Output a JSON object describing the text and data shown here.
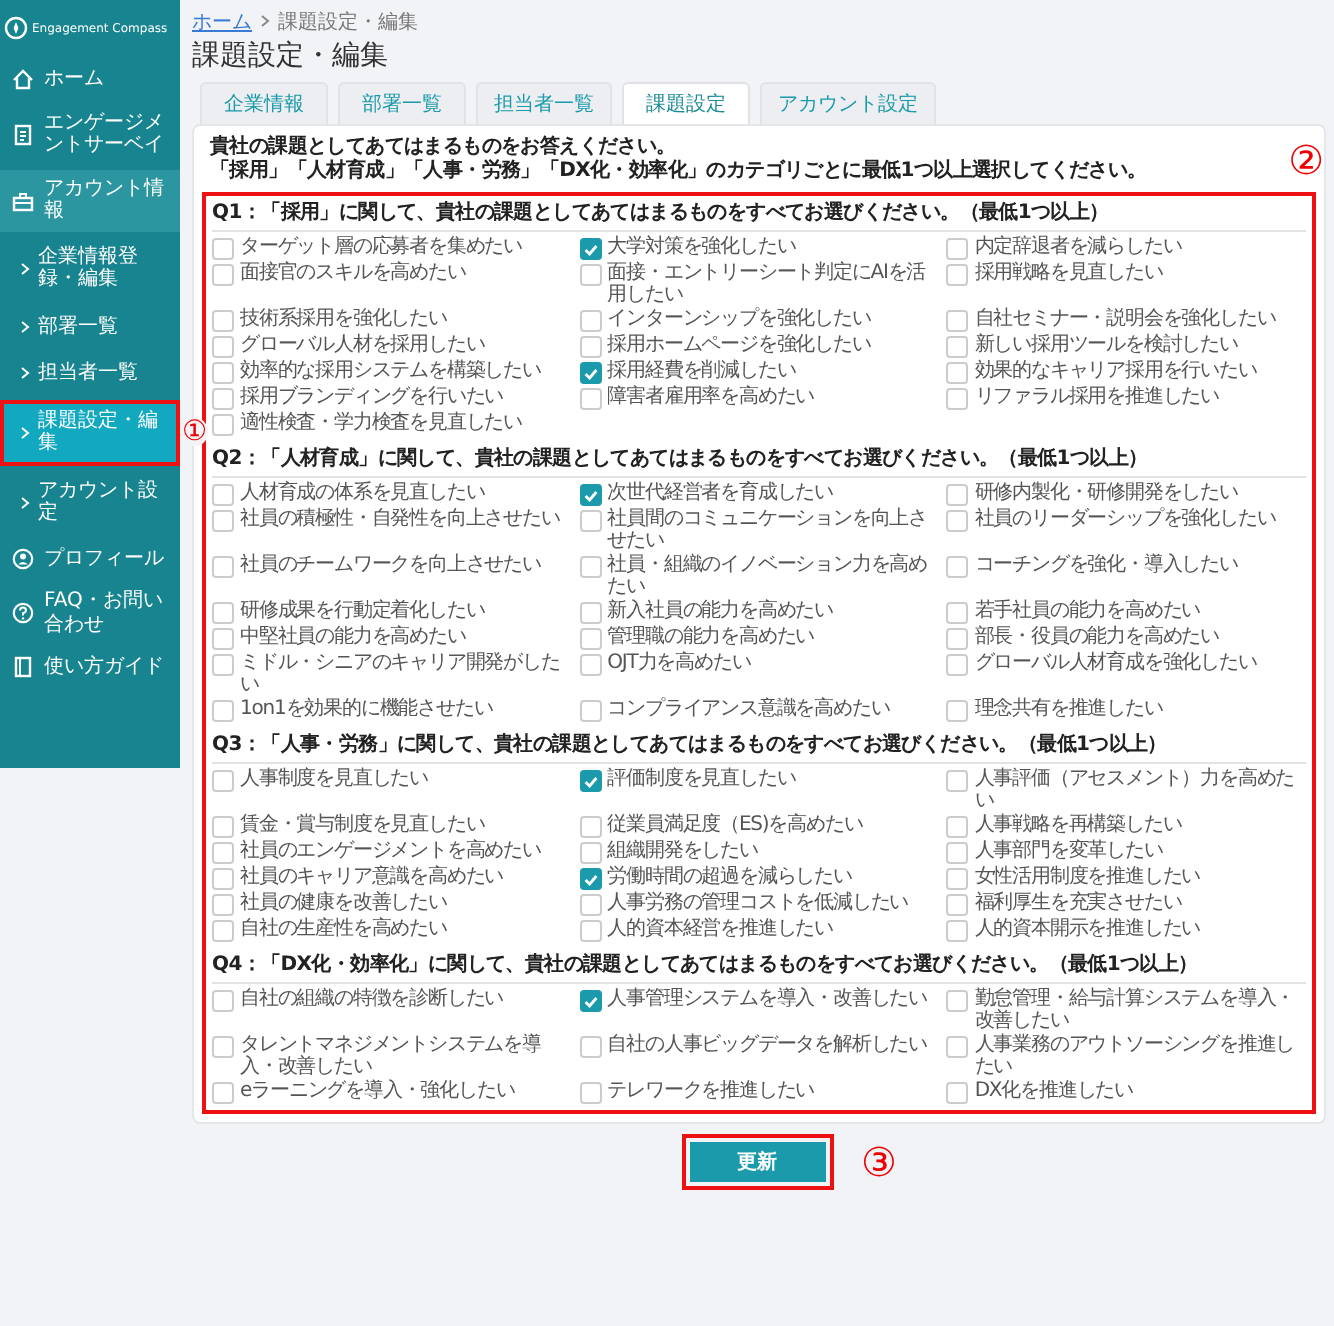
{
  "sidebar": {
    "logo": "Engagement Compass",
    "items": [
      {
        "label": "ホーム",
        "expanded": false
      },
      {
        "label": "エンゲージメントサーベイ",
        "expanded": false
      },
      {
        "label": "アカウント情報",
        "expanded": true,
        "children": [
          {
            "label": "企業情報登録・編集",
            "selected": false,
            "highlighted": false
          },
          {
            "label": "部署一覧",
            "selected": false,
            "highlighted": false
          },
          {
            "label": "担当者一覧",
            "selected": false,
            "highlighted": false
          },
          {
            "label": "課題設定・編集",
            "selected": true,
            "highlighted": true,
            "callout": "①"
          },
          {
            "label": "アカウント設定",
            "selected": false,
            "highlighted": false
          }
        ]
      },
      {
        "label": "プロフィール",
        "expanded": false
      },
      {
        "label": "FAQ・お問い合わせ",
        "expanded": false
      },
      {
        "label": "使い方ガイド",
        "expanded": false
      }
    ]
  },
  "breadcrumb": [
    {
      "label": "ホーム",
      "link": true
    },
    {
      "label": "課題設定・編集",
      "link": false
    }
  ],
  "title": "課題設定・編集",
  "tabs": [
    {
      "label": "企業情報",
      "selected": false
    },
    {
      "label": "部署一覧",
      "selected": false
    },
    {
      "label": "担当者一覧",
      "selected": false
    },
    {
      "label": "課題設定",
      "selected": true
    },
    {
      "label": "アカウント設定",
      "selected": false
    }
  ],
  "intro": [
    "貴社の課題としてあてはまるものをお答えください。",
    "「採用」「人材育成」「人事・労務」「DX化・効率化」のカテゴリごとに最低1つ以上選択してください。"
  ],
  "questions_panel": {
    "highlighted": true,
    "callout": "②"
  },
  "questions": [
    {
      "title": "Q1：「採用」に関して、貴社の課題としてあてはまるものをすべてお選びください。（最低1つ以上）",
      "options": [
        {
          "label": "ターゲット層の応募者を集めたい",
          "checked": false
        },
        {
          "label": "大学対策を強化したい",
          "checked": true
        },
        {
          "label": "内定辞退者を減らしたい",
          "checked": false
        },
        {
          "label": "面接官のスキルを高めたい",
          "checked": false
        },
        {
          "label": "面接・エントリーシート判定にAIを活用したい",
          "checked": false
        },
        {
          "label": "採用戦略を見直したい",
          "checked": false
        },
        {
          "label": "技術系採用を強化したい",
          "checked": false
        },
        {
          "label": "インターンシップを強化したい",
          "checked": false
        },
        {
          "label": "自社セミナー・説明会を強化したい",
          "checked": false
        },
        {
          "label": "グローバル人材を採用したい",
          "checked": false
        },
        {
          "label": "採用ホームページを強化したい",
          "checked": false
        },
        {
          "label": "新しい採用ツールを検討したい",
          "checked": false
        },
        {
          "label": "効率的な採用システムを構築したい",
          "checked": false
        },
        {
          "label": "採用経費を削減したい",
          "checked": true
        },
        {
          "label": "効果的なキャリア採用を行いたい",
          "checked": false
        },
        {
          "label": "採用ブランディングを行いたい",
          "checked": false
        },
        {
          "label": "障害者雇用率を高めたい",
          "checked": false
        },
        {
          "label": "リファラル採用を推進したい",
          "checked": false
        },
        {
          "label": "適性検査・学力検査を見直したい",
          "checked": false
        }
      ]
    },
    {
      "title": "Q2：「人材育成」に関して、貴社の課題としてあてはまるものをすべてお選びください。（最低1つ以上）",
      "options": [
        {
          "label": "人材育成の体系を見直したい",
          "checked": false
        },
        {
          "label": "次世代経営者を育成したい",
          "checked": true
        },
        {
          "label": "研修内製化・研修開発をしたい",
          "checked": false
        },
        {
          "label": "社員の積極性・自発性を向上させたい",
          "checked": false
        },
        {
          "label": "社員間のコミュニケーションを向上させたい",
          "checked": false
        },
        {
          "label": "社員のリーダーシップを強化したい",
          "checked": false
        },
        {
          "label": "社員のチームワークを向上させたい",
          "checked": false
        },
        {
          "label": "社員・組織のイノベーション力を高めたい",
          "checked": false
        },
        {
          "label": "コーチングを強化・導入したい",
          "checked": false
        },
        {
          "label": "研修成果を行動定着化したい",
          "checked": false
        },
        {
          "label": "新入社員の能力を高めたい",
          "checked": false
        },
        {
          "label": "若手社員の能力を高めたい",
          "checked": false
        },
        {
          "label": "中堅社員の能力を高めたい",
          "checked": false
        },
        {
          "label": "管理職の能力を高めたい",
          "checked": false
        },
        {
          "label": "部長・役員の能力を高めたい",
          "checked": false
        },
        {
          "label": "ミドル・シニアのキャリア開発がしたい",
          "checked": false
        },
        {
          "label": "OJT力を高めたい",
          "checked": false
        },
        {
          "label": "グローバル人材育成を強化したい",
          "checked": false
        },
        {
          "label": "1on1を効果的に機能させたい",
          "checked": false
        },
        {
          "label": "コンプライアンス意識を高めたい",
          "checked": false
        },
        {
          "label": "理念共有を推進したい",
          "checked": false
        }
      ]
    },
    {
      "title": "Q3：「人事・労務」に関して、貴社の課題としてあてはまるものをすべてお選びください。（最低1つ以上）",
      "options": [
        {
          "label": "人事制度を見直したい",
          "checked": false
        },
        {
          "label": "評価制度を見直したい",
          "checked": true
        },
        {
          "label": "人事評価（アセスメント）力を高めたい",
          "checked": false
        },
        {
          "label": "賃金・賞与制度を見直したい",
          "checked": false
        },
        {
          "label": "従業員満足度（ES)を高めたい",
          "checked": false
        },
        {
          "label": "人事戦略を再構築したい",
          "checked": false
        },
        {
          "label": "社員のエンゲージメントを高めたい",
          "checked": false
        },
        {
          "label": "組織開発をしたい",
          "checked": false
        },
        {
          "label": "人事部門を変革したい",
          "checked": false
        },
        {
          "label": "社員のキャリア意識を高めたい",
          "checked": false
        },
        {
          "label": "労働時間の超過を減らしたい",
          "checked": true
        },
        {
          "label": "女性活用制度を推進したい",
          "checked": false
        },
        {
          "label": "社員の健康を改善したい",
          "checked": false
        },
        {
          "label": "人事労務の管理コストを低減したい",
          "checked": false
        },
        {
          "label": "福利厚生を充実させたい",
          "checked": false
        },
        {
          "label": "自社の生産性を高めたい",
          "checked": false
        },
        {
          "label": "人的資本経営を推進したい",
          "checked": false
        },
        {
          "label": "人的資本開示を推進したい",
          "checked": false
        }
      ]
    },
    {
      "title": "Q4：「DX化・効率化」に関して、貴社の課題としてあてはまるものをすべてお選びください。（最低1つ以上）",
      "options": [
        {
          "label": "自社の組織の特徴を診断したい",
          "checked": false
        },
        {
          "label": "人事管理システムを導入・改善したい",
          "checked": true
        },
        {
          "label": "勤怠管理・給与計算システムを導入・改善したい",
          "checked": false
        },
        {
          "label": "タレントマネジメントシステムを導入・改善したい",
          "checked": false
        },
        {
          "label": "自社の人事ビッグデータを解析したい",
          "checked": false
        },
        {
          "label": "人事業務のアウトソーシングを推進したい",
          "checked": false
        },
        {
          "label": "eラーニングを導入・強化したい",
          "checked": false
        },
        {
          "label": "テレワークを推進したい",
          "checked": false
        },
        {
          "label": "DX化を推進したい",
          "checked": false
        }
      ]
    }
  ],
  "update_button": {
    "label": "更新",
    "highlighted": true,
    "callout": "③"
  }
}
